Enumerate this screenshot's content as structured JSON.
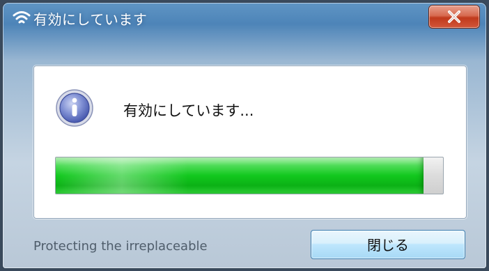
{
  "window": {
    "title": "有効にしています",
    "title_icon": "wifi-icon",
    "close_icon": "close-icon"
  },
  "dialog": {
    "message": "有効にしています...",
    "message_icon": "info-icon",
    "progress_percent": 95
  },
  "footer": {
    "tagline": "Protecting the irreplaceable",
    "close_button_label": "閉じる"
  },
  "colors": {
    "progress": "#12c81e",
    "close_button": "#c0391c",
    "action_button": "#bee6fd"
  }
}
